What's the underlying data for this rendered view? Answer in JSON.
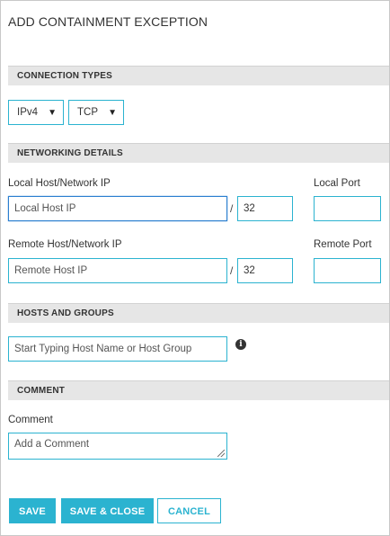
{
  "dialog": {
    "title": "ADD CONTAINMENT EXCEPTION"
  },
  "connection_types": {
    "header": "CONNECTION TYPES",
    "ip_version": {
      "value": "IPv4"
    },
    "protocol": {
      "value": "TCP"
    }
  },
  "networking_details": {
    "header": "NETWORKING DETAILS",
    "local_host_label": "Local Host/Network IP",
    "local_host_placeholder": "Local Host IP",
    "local_prefix_value": "32",
    "local_port_label": "Local Port",
    "local_port_value": "",
    "remote_host_label": "Remote Host/Network IP",
    "remote_host_placeholder": "Remote Host IP",
    "remote_prefix_value": "32",
    "remote_port_label": "Remote Port",
    "remote_port_value": "",
    "separator": "/"
  },
  "hosts_and_groups": {
    "header": "HOSTS AND GROUPS",
    "search_placeholder": "Start Typing Host Name or Host Group",
    "info_icon": "i"
  },
  "comment": {
    "header": "COMMENT",
    "label": "Comment",
    "placeholder": "Add a Comment"
  },
  "actions": {
    "save": "SAVE",
    "save_close": "SAVE & CLOSE",
    "cancel": "CANCEL"
  },
  "colors": {
    "accent": "#2bb3d0",
    "header_bg": "#e6e6e6"
  },
  "icons": {
    "dropdown": "caret-down-icon",
    "info": "info-icon",
    "resize": "resize-grip-icon"
  }
}
